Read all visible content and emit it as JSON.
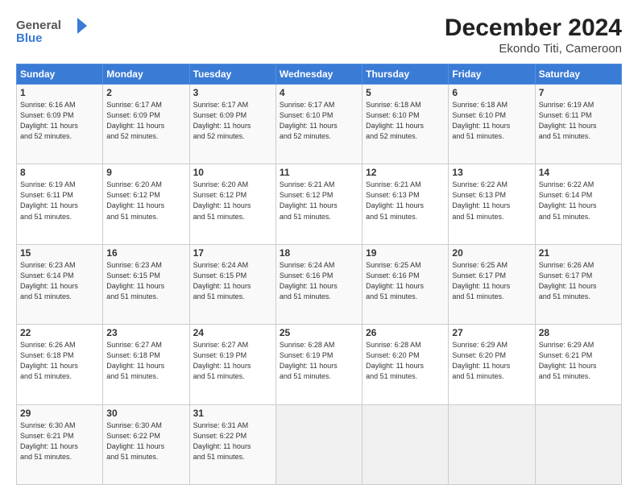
{
  "logo": {
    "line1": "General",
    "line2": "Blue"
  },
  "title": "December 2024",
  "subtitle": "Ekondo Titi, Cameroon",
  "weekdays": [
    "Sunday",
    "Monday",
    "Tuesday",
    "Wednesday",
    "Thursday",
    "Friday",
    "Saturday"
  ],
  "weeks": [
    [
      {
        "day": "1",
        "info": "Sunrise: 6:16 AM\nSunset: 6:09 PM\nDaylight: 11 hours\nand 52 minutes."
      },
      {
        "day": "2",
        "info": "Sunrise: 6:17 AM\nSunset: 6:09 PM\nDaylight: 11 hours\nand 52 minutes."
      },
      {
        "day": "3",
        "info": "Sunrise: 6:17 AM\nSunset: 6:09 PM\nDaylight: 11 hours\nand 52 minutes."
      },
      {
        "day": "4",
        "info": "Sunrise: 6:17 AM\nSunset: 6:10 PM\nDaylight: 11 hours\nand 52 minutes."
      },
      {
        "day": "5",
        "info": "Sunrise: 6:18 AM\nSunset: 6:10 PM\nDaylight: 11 hours\nand 52 minutes."
      },
      {
        "day": "6",
        "info": "Sunrise: 6:18 AM\nSunset: 6:10 PM\nDaylight: 11 hours\nand 51 minutes."
      },
      {
        "day": "7",
        "info": "Sunrise: 6:19 AM\nSunset: 6:11 PM\nDaylight: 11 hours\nand 51 minutes."
      }
    ],
    [
      {
        "day": "8",
        "info": "Sunrise: 6:19 AM\nSunset: 6:11 PM\nDaylight: 11 hours\nand 51 minutes."
      },
      {
        "day": "9",
        "info": "Sunrise: 6:20 AM\nSunset: 6:12 PM\nDaylight: 11 hours\nand 51 minutes."
      },
      {
        "day": "10",
        "info": "Sunrise: 6:20 AM\nSunset: 6:12 PM\nDaylight: 11 hours\nand 51 minutes."
      },
      {
        "day": "11",
        "info": "Sunrise: 6:21 AM\nSunset: 6:12 PM\nDaylight: 11 hours\nand 51 minutes."
      },
      {
        "day": "12",
        "info": "Sunrise: 6:21 AM\nSunset: 6:13 PM\nDaylight: 11 hours\nand 51 minutes."
      },
      {
        "day": "13",
        "info": "Sunrise: 6:22 AM\nSunset: 6:13 PM\nDaylight: 11 hours\nand 51 minutes."
      },
      {
        "day": "14",
        "info": "Sunrise: 6:22 AM\nSunset: 6:14 PM\nDaylight: 11 hours\nand 51 minutes."
      }
    ],
    [
      {
        "day": "15",
        "info": "Sunrise: 6:23 AM\nSunset: 6:14 PM\nDaylight: 11 hours\nand 51 minutes."
      },
      {
        "day": "16",
        "info": "Sunrise: 6:23 AM\nSunset: 6:15 PM\nDaylight: 11 hours\nand 51 minutes."
      },
      {
        "day": "17",
        "info": "Sunrise: 6:24 AM\nSunset: 6:15 PM\nDaylight: 11 hours\nand 51 minutes."
      },
      {
        "day": "18",
        "info": "Sunrise: 6:24 AM\nSunset: 6:16 PM\nDaylight: 11 hours\nand 51 minutes."
      },
      {
        "day": "19",
        "info": "Sunrise: 6:25 AM\nSunset: 6:16 PM\nDaylight: 11 hours\nand 51 minutes."
      },
      {
        "day": "20",
        "info": "Sunrise: 6:25 AM\nSunset: 6:17 PM\nDaylight: 11 hours\nand 51 minutes."
      },
      {
        "day": "21",
        "info": "Sunrise: 6:26 AM\nSunset: 6:17 PM\nDaylight: 11 hours\nand 51 minutes."
      }
    ],
    [
      {
        "day": "22",
        "info": "Sunrise: 6:26 AM\nSunset: 6:18 PM\nDaylight: 11 hours\nand 51 minutes."
      },
      {
        "day": "23",
        "info": "Sunrise: 6:27 AM\nSunset: 6:18 PM\nDaylight: 11 hours\nand 51 minutes."
      },
      {
        "day": "24",
        "info": "Sunrise: 6:27 AM\nSunset: 6:19 PM\nDaylight: 11 hours\nand 51 minutes."
      },
      {
        "day": "25",
        "info": "Sunrise: 6:28 AM\nSunset: 6:19 PM\nDaylight: 11 hours\nand 51 minutes."
      },
      {
        "day": "26",
        "info": "Sunrise: 6:28 AM\nSunset: 6:20 PM\nDaylight: 11 hours\nand 51 minutes."
      },
      {
        "day": "27",
        "info": "Sunrise: 6:29 AM\nSunset: 6:20 PM\nDaylight: 11 hours\nand 51 minutes."
      },
      {
        "day": "28",
        "info": "Sunrise: 6:29 AM\nSunset: 6:21 PM\nDaylight: 11 hours\nand 51 minutes."
      }
    ],
    [
      {
        "day": "29",
        "info": "Sunrise: 6:30 AM\nSunset: 6:21 PM\nDaylight: 11 hours\nand 51 minutes."
      },
      {
        "day": "30",
        "info": "Sunrise: 6:30 AM\nSunset: 6:22 PM\nDaylight: 11 hours\nand 51 minutes."
      },
      {
        "day": "31",
        "info": "Sunrise: 6:31 AM\nSunset: 6:22 PM\nDaylight: 11 hours\nand 51 minutes."
      },
      null,
      null,
      null,
      null
    ]
  ]
}
